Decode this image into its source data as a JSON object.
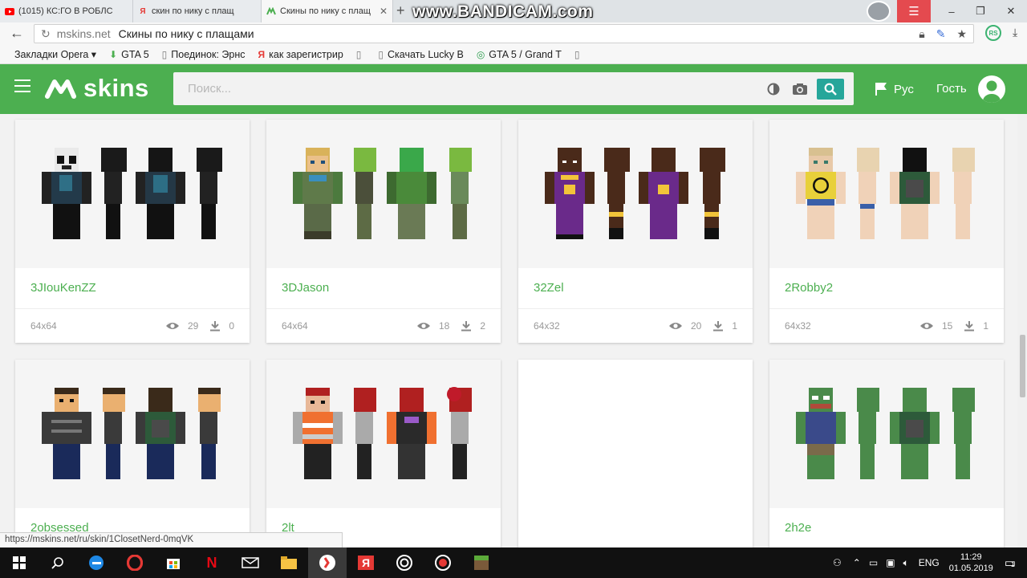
{
  "browser": {
    "tabs": [
      {
        "title": "(1015) КС:ГО В РОБЛС",
        "icon": "youtube-icon",
        "color": "#ff0000"
      },
      {
        "title": "скин по нику с плащ",
        "icon": "yandex-icon",
        "color": "#e53935"
      },
      {
        "title": "Скины по нику с плащ",
        "icon": "mskins-icon",
        "color": "#4caf50",
        "active": true
      }
    ],
    "watermark": "www.BANDICAM.com",
    "address": {
      "domain": "mskins.net",
      "title": "Скины по нику с плащами"
    },
    "bookmarks": [
      {
        "label": "Закладки Opera ▾",
        "icon": ""
      },
      {
        "label": "GTA 5",
        "icon": "green-arrow-icon"
      },
      {
        "label": "Поединок: Эрнс",
        "icon": "page-icon"
      },
      {
        "label": "как зарегистрир",
        "icon": "yandex-icon"
      },
      {
        "label": "",
        "icon": "page-icon"
      },
      {
        "label": "Скачать Lucky B",
        "icon": "page-icon"
      },
      {
        "label": "GTA 5 / Grand T",
        "icon": "green-circle-icon"
      },
      {
        "label": "",
        "icon": "page-icon"
      }
    ],
    "status_url": "https://mskins.net/ru/skin/1ClosetNerd-0mqVK"
  },
  "site": {
    "logo_text": "skins",
    "search_placeholder": "Поиск...",
    "language": "Рус",
    "user": "Гость",
    "accent": "#4caf50",
    "search_button_color": "#26a69a"
  },
  "skins": [
    {
      "name": "3JIouKenZZ",
      "resolution": "64x64",
      "views": "29",
      "downloads": "0"
    },
    {
      "name": "3DJason",
      "resolution": "64x64",
      "views": "18",
      "downloads": "2"
    },
    {
      "name": "32Zel",
      "resolution": "64x32",
      "views": "20",
      "downloads": "1"
    },
    {
      "name": "2Robby2",
      "resolution": "64x32",
      "views": "15",
      "downloads": "1"
    },
    {
      "name": "2obsessed",
      "resolution": "",
      "views": "",
      "downloads": ""
    },
    {
      "name": "2lt",
      "resolution": "",
      "views": "",
      "downloads": ""
    },
    {
      "name": "",
      "resolution": "",
      "views": "",
      "downloads": ""
    },
    {
      "name": "2h2e",
      "resolution": "",
      "views": "",
      "downloads": ""
    }
  ],
  "taskbar": {
    "language": "ENG",
    "time": "11:29",
    "date": "01.05.2019",
    "notifications": "1"
  }
}
